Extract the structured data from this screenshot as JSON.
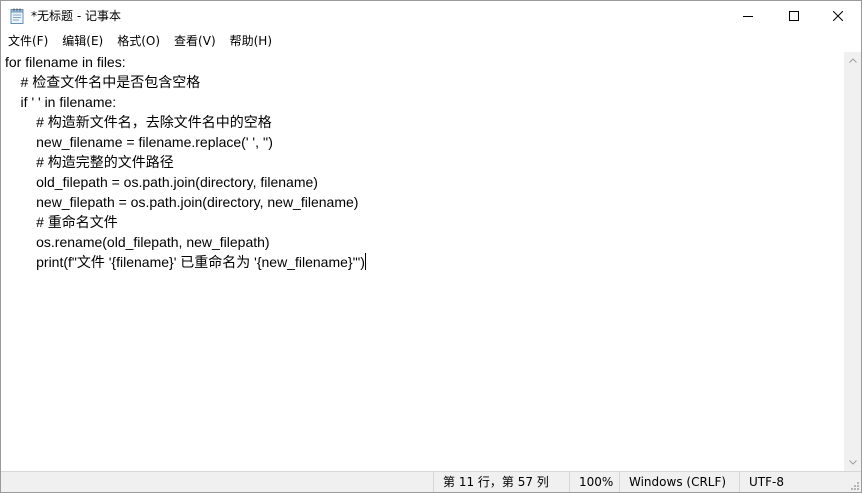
{
  "window": {
    "title": "*无标题 - 记事本"
  },
  "menu": {
    "items": [
      {
        "label": "文件(F)"
      },
      {
        "label": "编辑(E)"
      },
      {
        "label": "格式(O)"
      },
      {
        "label": "查看(V)"
      },
      {
        "label": "帮助(H)"
      }
    ]
  },
  "editor": {
    "lines": [
      "for filename in files:",
      "    # 检查文件名中是否包含空格",
      "    if ' ' in filename:",
      "        # 构造新文件名，去除文件名中的空格",
      "        new_filename = filename.replace(' ', '')",
      "        # 构造完整的文件路径",
      "        old_filepath = os.path.join(directory, filename)",
      "        new_filepath = os.path.join(directory, new_filename)",
      "        # 重命名文件",
      "        os.rename(old_filepath, new_filepath)",
      "        print(f\"文件 '{filename}' 已重命名为 '{new_filename}'\")"
    ]
  },
  "status": {
    "position": "第 11 行，第 57 列",
    "zoom": "100%",
    "line_ending": "Windows (CRLF)",
    "encoding": "UTF-8"
  },
  "icons": {
    "app": "notepad-icon",
    "minimize": "minimize-icon",
    "maximize": "maximize-icon",
    "close": "close-icon"
  }
}
